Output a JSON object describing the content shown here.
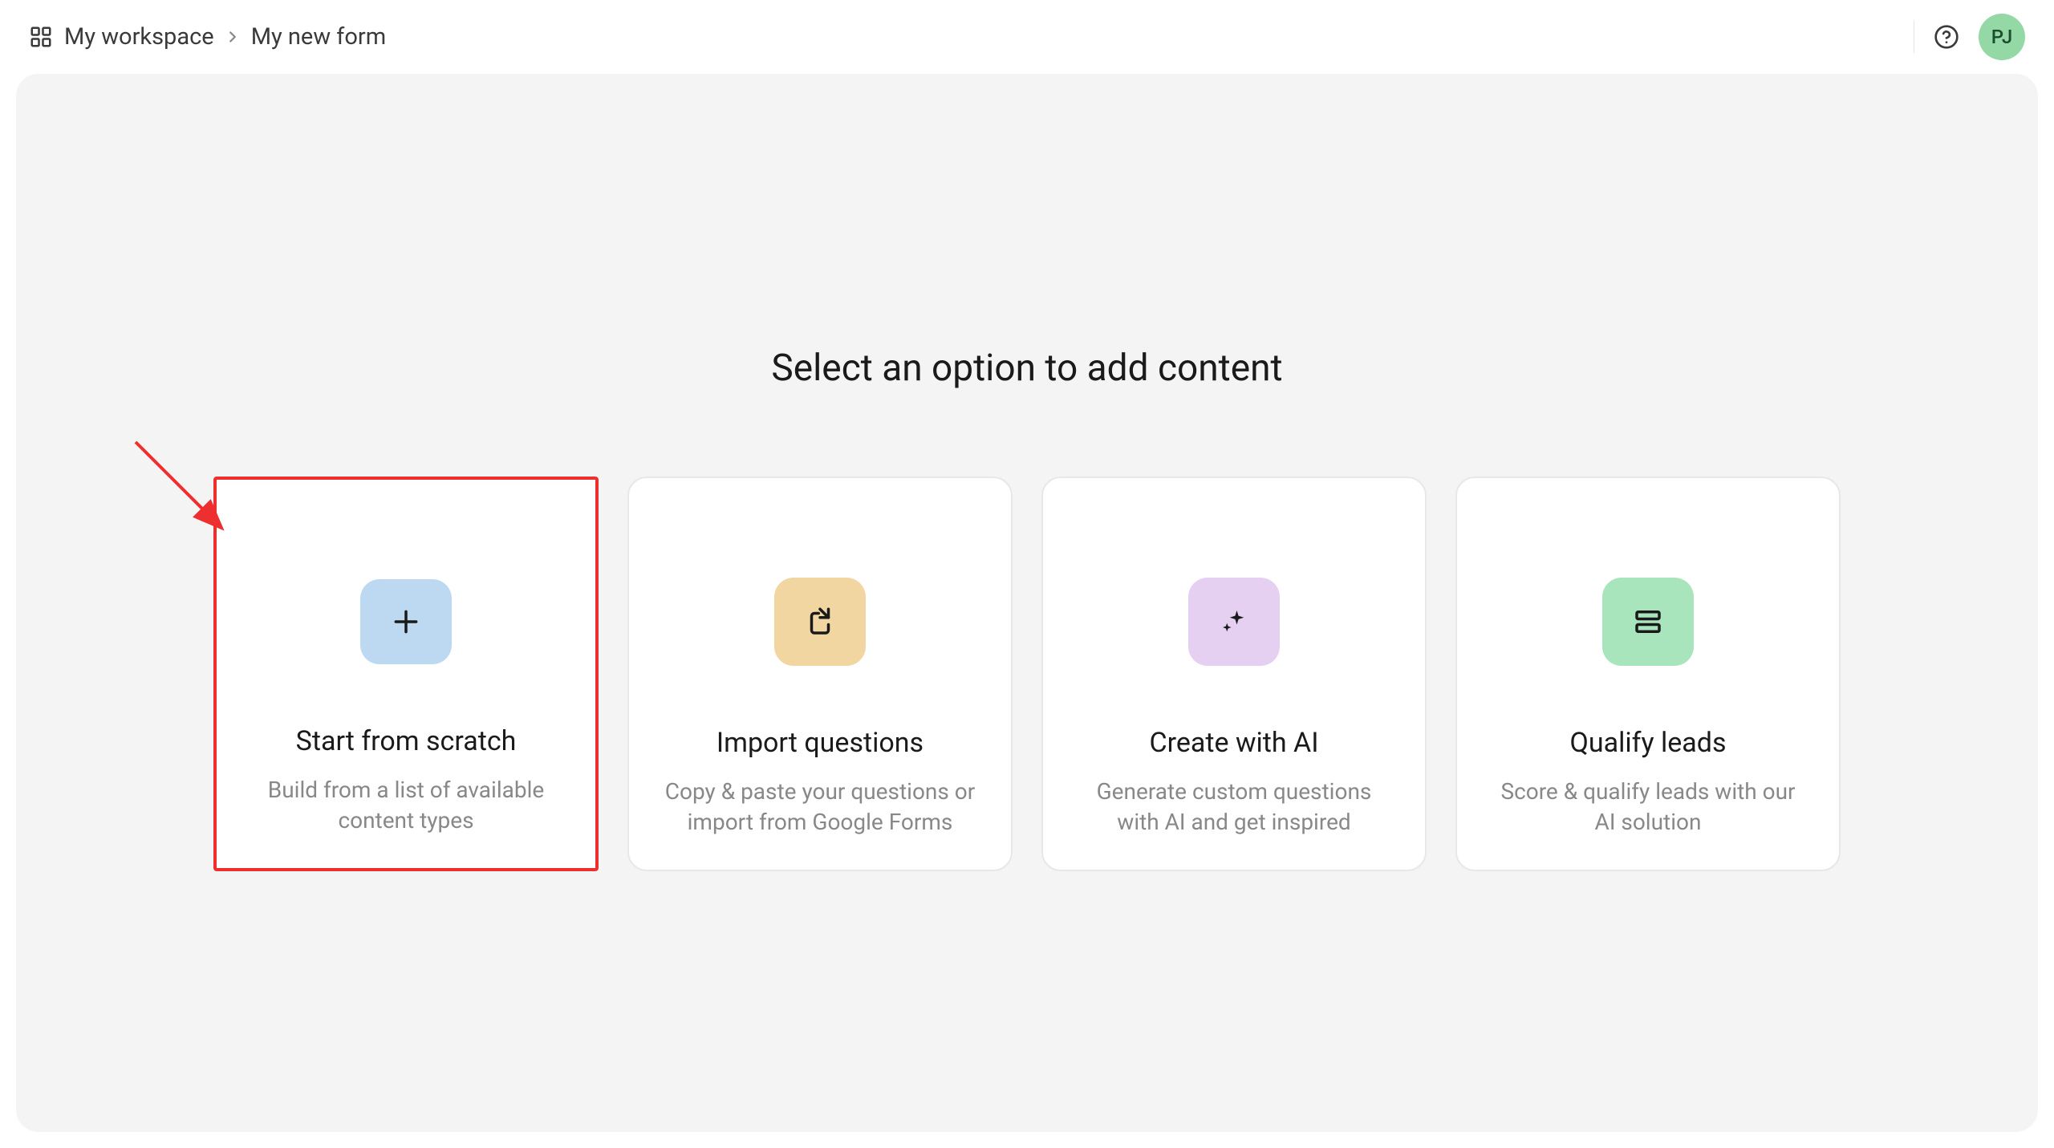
{
  "breadcrumb": {
    "root": "My workspace",
    "current": "My new form"
  },
  "header": {
    "avatar_initials": "PJ"
  },
  "main": {
    "title": "Select an option to add content"
  },
  "options": [
    {
      "title": "Start from scratch",
      "desc": "Build from a list of available content types",
      "icon": "plus-icon",
      "color": "blue",
      "highlighted": true
    },
    {
      "title": "Import questions",
      "desc": "Copy & paste your questions or import from Google Forms",
      "icon": "import-icon",
      "color": "tan",
      "highlighted": false
    },
    {
      "title": "Create with AI",
      "desc": "Generate custom questions with AI and get inspired",
      "icon": "sparkle-icon",
      "color": "purple",
      "highlighted": false
    },
    {
      "title": "Qualify leads",
      "desc": "Score & qualify leads with our AI solution",
      "icon": "list-icon",
      "color": "green",
      "highlighted": false
    }
  ]
}
